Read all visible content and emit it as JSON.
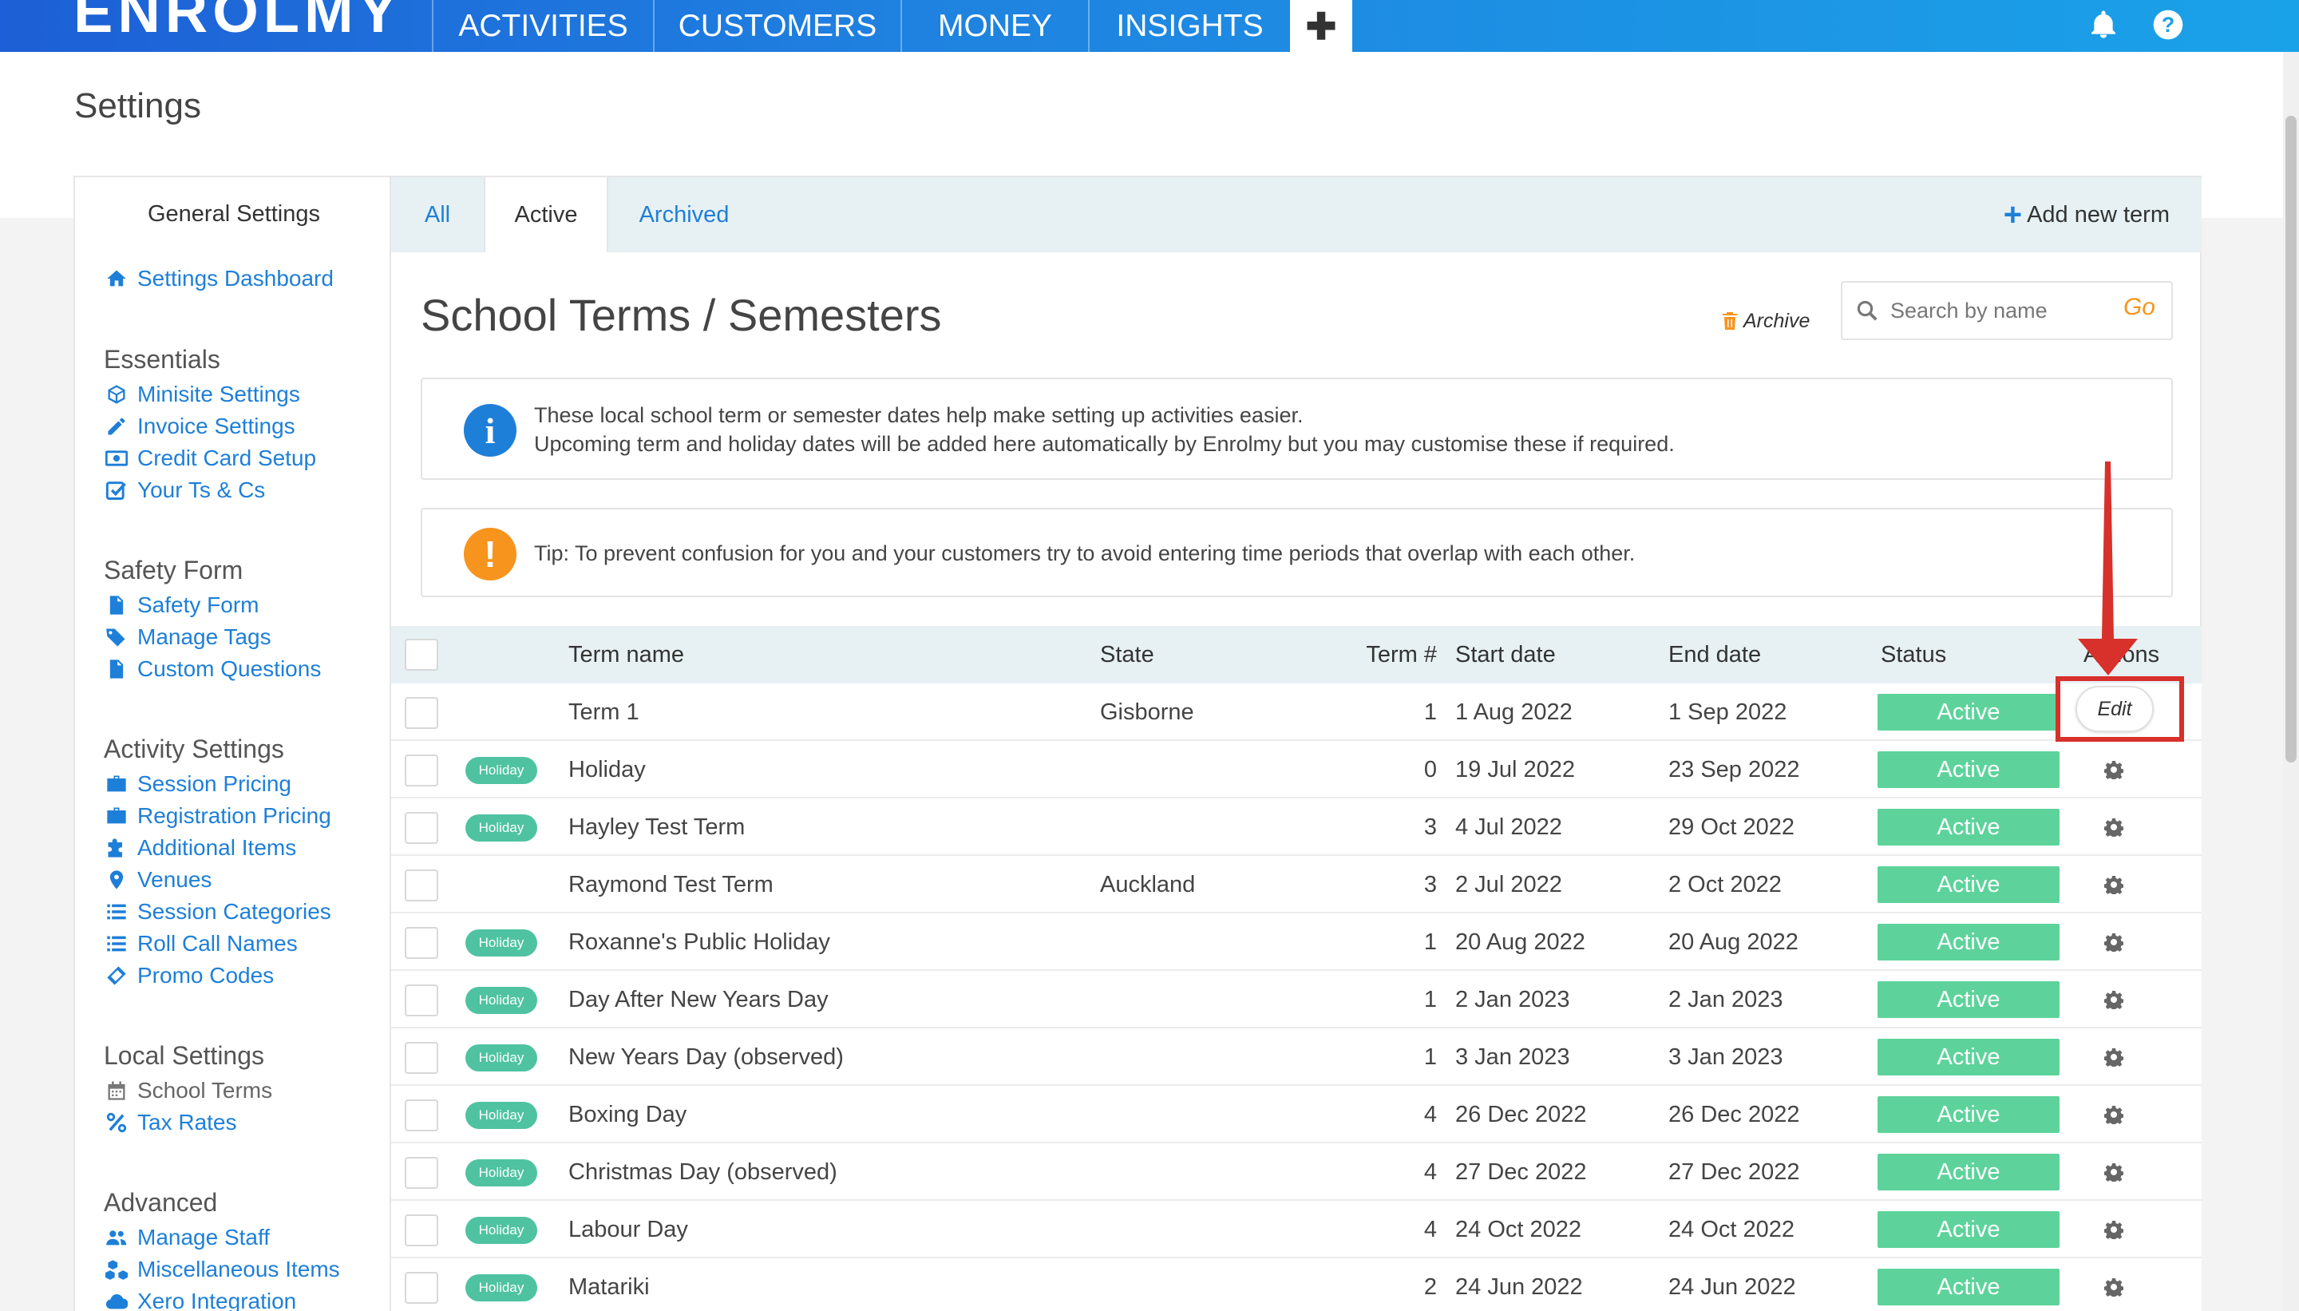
{
  "brand": "ENROLMY",
  "nav": {
    "tabs": [
      "ACTIVITIES",
      "CUSTOMERS",
      "MONEY",
      "INSIGHTS"
    ],
    "plus_label": "✚",
    "bell_icon": "bell-icon",
    "help_icon": "question-circle-icon"
  },
  "page": {
    "title": "Settings"
  },
  "sidebar": {
    "header": "General Settings",
    "dashboard": "Settings Dashboard",
    "sections": {
      "essentials": {
        "title": "Essentials",
        "items": [
          "Minisite Settings",
          "Invoice Settings",
          "Credit Card Setup",
          "Your Ts & Cs"
        ]
      },
      "safety": {
        "title": "Safety Form",
        "items": [
          "Safety Form",
          "Manage Tags",
          "Custom Questions"
        ]
      },
      "activity": {
        "title": "Activity Settings",
        "items": [
          "Session Pricing",
          "Registration Pricing",
          "Additional Items",
          "Venues",
          "Session Categories",
          "Roll Call Names",
          "Promo Codes"
        ]
      },
      "local": {
        "title": "Local Settings",
        "items": [
          "School Terms",
          "Tax Rates"
        ]
      },
      "advanced": {
        "title": "Advanced",
        "items": [
          "Manage Staff",
          "Miscellaneous Items",
          "Xero Integration"
        ]
      }
    }
  },
  "tabs": {
    "all": "All",
    "active": "Active",
    "archived": "Archived",
    "add_new": "Add new term"
  },
  "main": {
    "title": "School Terms / Semesters",
    "archive_label": "Archive",
    "search_placeholder": "Search by name",
    "go_label": "Go",
    "info_line1": "These local school term or semester dates help make setting up activities easier.",
    "info_line2": "Upcoming term and holiday dates will be added here automatically by Enrolmy but you may customise these if required.",
    "tip": "Tip: To prevent confusion for you and your customers try to avoid entering time periods that overlap with each other."
  },
  "table": {
    "headers": {
      "name": "Term name",
      "state": "State",
      "term_no": "Term #",
      "start": "Start date",
      "end": "End date",
      "status": "Status",
      "actions": "Actions"
    },
    "holiday_badge": "Holiday",
    "edit_label": "Edit",
    "rows": [
      {
        "holiday": false,
        "name": "Term 1",
        "state": "Gisborne",
        "term_no": "1",
        "start": "1 Aug 2022",
        "end": "1 Sep 2022",
        "status": "Active"
      },
      {
        "holiday": true,
        "name": "Holiday",
        "state": "",
        "term_no": "0",
        "start": "19 Jul 2022",
        "end": "23 Sep 2022",
        "status": "Active"
      },
      {
        "holiday": true,
        "name": "Hayley Test Term",
        "state": "",
        "term_no": "3",
        "start": "4 Jul 2022",
        "end": "29 Oct 2022",
        "status": "Active"
      },
      {
        "holiday": false,
        "name": "Raymond Test Term",
        "state": "Auckland",
        "term_no": "3",
        "start": "2 Jul 2022",
        "end": "2 Oct 2022",
        "status": "Active"
      },
      {
        "holiday": true,
        "name": "Roxanne's Public Holiday",
        "state": "",
        "term_no": "1",
        "start": "20 Aug 2022",
        "end": "20 Aug 2022",
        "status": "Active"
      },
      {
        "holiday": true,
        "name": "Day After New Years Day",
        "state": "",
        "term_no": "1",
        "start": "2 Jan 2023",
        "end": "2 Jan 2023",
        "status": "Active"
      },
      {
        "holiday": true,
        "name": "New Years Day (observed)",
        "state": "",
        "term_no": "1",
        "start": "3 Jan 2023",
        "end": "3 Jan 2023",
        "status": "Active"
      },
      {
        "holiday": true,
        "name": "Boxing Day",
        "state": "",
        "term_no": "4",
        "start": "26 Dec 2022",
        "end": "26 Dec 2022",
        "status": "Active"
      },
      {
        "holiday": true,
        "name": "Christmas Day (observed)",
        "state": "",
        "term_no": "4",
        "start": "27 Dec 2022",
        "end": "27 Dec 2022",
        "status": "Active"
      },
      {
        "holiday": true,
        "name": "Labour Day",
        "state": "",
        "term_no": "4",
        "start": "24 Oct 2022",
        "end": "24 Oct 2022",
        "status": "Active"
      },
      {
        "holiday": true,
        "name": "Matariki",
        "state": "",
        "term_no": "2",
        "start": "24 Jun 2022",
        "end": "24 Jun 2022",
        "status": "Active"
      }
    ]
  },
  "colors": {
    "nav_start": "#1d5fd6",
    "nav_end": "#1aa2e8",
    "link": "#1e7fd8",
    "status_active": "#5dd39b",
    "holiday_badge": "#4fc3a1",
    "info_icon": "#1e7fd8",
    "tip_icon": "#f7941d",
    "highlight": "#d8302b"
  }
}
